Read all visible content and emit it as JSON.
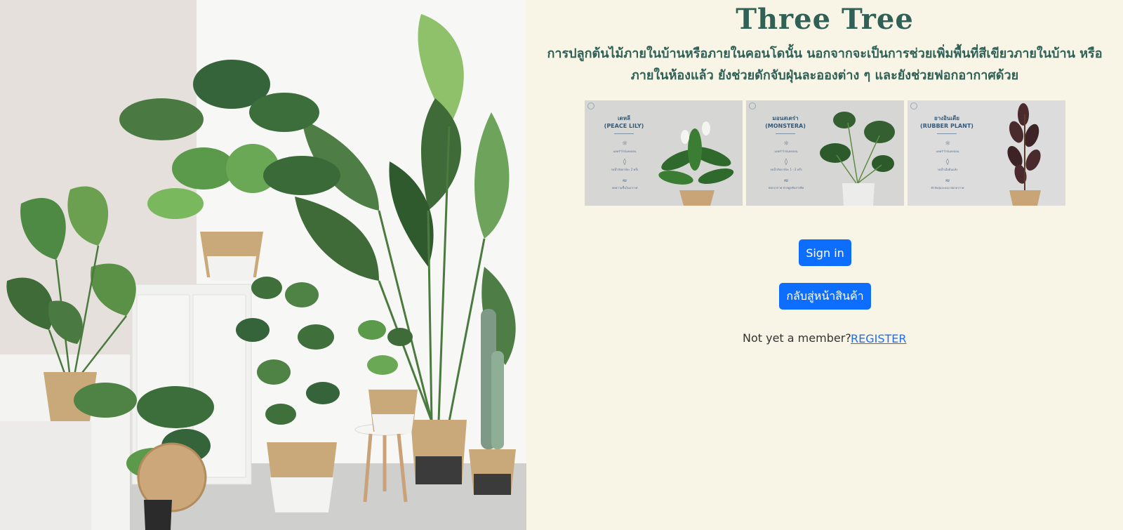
{
  "brand": {
    "title": "Three Tree",
    "tagline": "การปลูกต้นไม้ภายในบ้านหรือภายในคอนโดนั้น นอกจากจะเป็นการช่วยเพิ่มพื้นที่สีเขียวภายในบ้าน หรือภายในห้องแล้ว ยังช่วยดักจับฝุ่นละอองต่าง ๆ และยังช่วยฟอกอากาศด้วย"
  },
  "hero_image": {
    "subject": "indoor-plants-photo"
  },
  "plants": [
    {
      "name_th": "เดหลี",
      "name_en": "(PEACE LILY)",
      "tips": [
        "แดดรำไร/แดดอ่อน",
        "รดน้ำสัปดาห์ละ 2 ครั้ง",
        "ลดความชื้นในอากาศ"
      ]
    },
    {
      "name_th": "มอนสเตร่า",
      "name_en": "(MONSTERA)",
      "tips": [
        "แดดรำไร/แดดอ่อน",
        "รดน้ำสัปดาห์ละ 1 - 2 ครั้ง",
        "ฟอกอากาศ ช่วยดูดซับสารพิษ"
      ]
    },
    {
      "name_th": "ยางอินเดีย",
      "name_en": "(RUBBER PLANT)",
      "tips": [
        "แดดรำไร/แดดอ่อน",
        "รดน้ำเมื่อดินแห้ง",
        "ดักจับฝุ่นละออง ฟอกอากาศ"
      ]
    }
  ],
  "actions": {
    "signin_label": "Sign in",
    "back_label": "กลับสู่หน้าสินค้า",
    "member_prompt": "Not yet a member?",
    "register_label": "REGISTER"
  },
  "colors": {
    "background": "#f8f4e6",
    "title": "#2f6157",
    "primary_button": "#0d6efd",
    "link": "#1e6ef2"
  }
}
